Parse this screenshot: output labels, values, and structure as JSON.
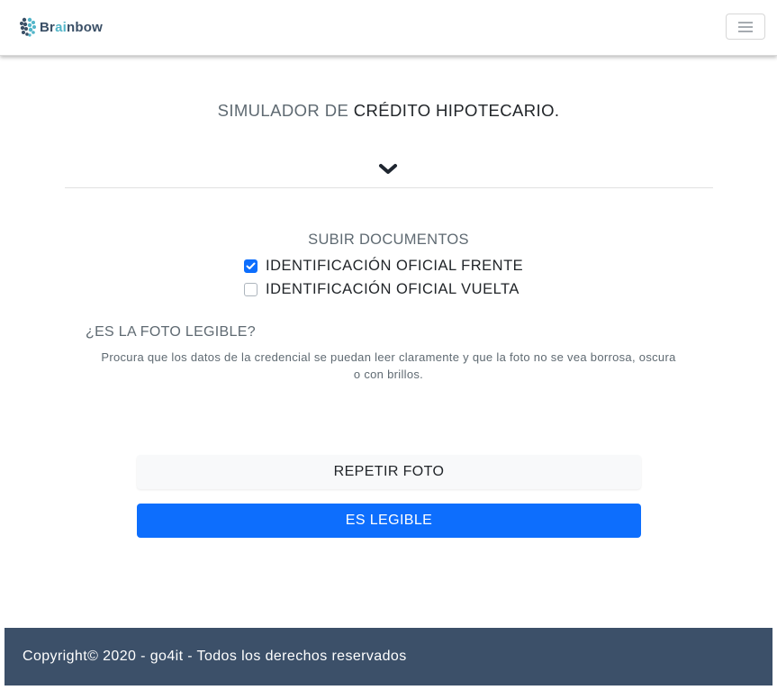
{
  "brand": {
    "logo_icon": "brain-logo-icon",
    "name_parts": [
      "Br",
      "ai",
      "nbow"
    ],
    "colors": {
      "dark": "#3a4f66",
      "accent": "#52b5c9"
    }
  },
  "navbar": {
    "toggle_icon": "hamburger-menu-icon"
  },
  "header": {
    "title_prefix": "SIMULADOR DE",
    "title_main": "CRÉDITO HIPOTECARIO.",
    "expand_icon": "chevron-down-icon"
  },
  "upload": {
    "section_title": "SUBIR DOCUMENTOS",
    "documents": [
      {
        "label": "IDENTIFICACIÓN OFICIAL FRENTE",
        "checked": true
      },
      {
        "label": "IDENTIFICACIÓN OFICIAL VUELTA",
        "checked": false
      }
    ]
  },
  "legibility": {
    "question": "¿ES LA FOTO LEGIBLE?",
    "hint": "Procura que los datos de la credencial se puedan leer claramente y que la foto no se vea borrosa, oscura o con brillos."
  },
  "actions": {
    "retake_label": "REPETIR FOTO",
    "confirm_label": "ES LEGIBLE"
  },
  "footer": {
    "copyright": "Copyright© 2020 - go4it - Todos los derechos reservados"
  },
  "colors": {
    "primary": "#0d6efd",
    "footer_bg": "#3c5069",
    "muted_text": "#5f6a72"
  }
}
